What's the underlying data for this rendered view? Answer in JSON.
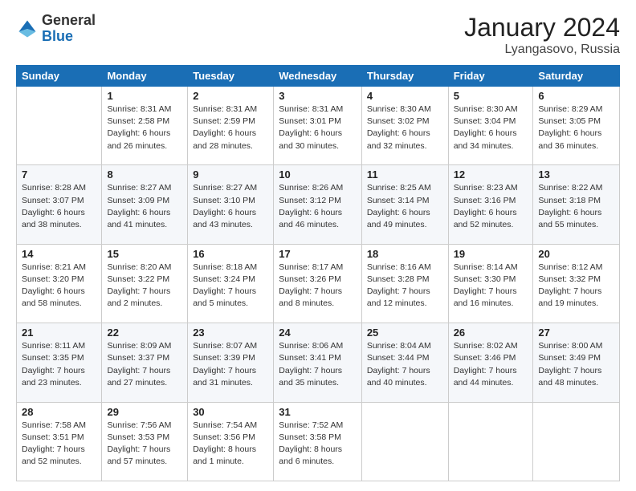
{
  "logo": {
    "general": "General",
    "blue": "Blue"
  },
  "title": "January 2024",
  "location": "Lyangasovo, Russia",
  "days_of_week": [
    "Sunday",
    "Monday",
    "Tuesday",
    "Wednesday",
    "Thursday",
    "Friday",
    "Saturday"
  ],
  "weeks": [
    [
      {
        "day": "",
        "info": ""
      },
      {
        "day": "1",
        "info": "Sunrise: 8:31 AM\nSunset: 2:58 PM\nDaylight: 6 hours\nand 26 minutes."
      },
      {
        "day": "2",
        "info": "Sunrise: 8:31 AM\nSunset: 2:59 PM\nDaylight: 6 hours\nand 28 minutes."
      },
      {
        "day": "3",
        "info": "Sunrise: 8:31 AM\nSunset: 3:01 PM\nDaylight: 6 hours\nand 30 minutes."
      },
      {
        "day": "4",
        "info": "Sunrise: 8:30 AM\nSunset: 3:02 PM\nDaylight: 6 hours\nand 32 minutes."
      },
      {
        "day": "5",
        "info": "Sunrise: 8:30 AM\nSunset: 3:04 PM\nDaylight: 6 hours\nand 34 minutes."
      },
      {
        "day": "6",
        "info": "Sunrise: 8:29 AM\nSunset: 3:05 PM\nDaylight: 6 hours\nand 36 minutes."
      }
    ],
    [
      {
        "day": "7",
        "info": "Sunrise: 8:28 AM\nSunset: 3:07 PM\nDaylight: 6 hours\nand 38 minutes."
      },
      {
        "day": "8",
        "info": "Sunrise: 8:27 AM\nSunset: 3:09 PM\nDaylight: 6 hours\nand 41 minutes."
      },
      {
        "day": "9",
        "info": "Sunrise: 8:27 AM\nSunset: 3:10 PM\nDaylight: 6 hours\nand 43 minutes."
      },
      {
        "day": "10",
        "info": "Sunrise: 8:26 AM\nSunset: 3:12 PM\nDaylight: 6 hours\nand 46 minutes."
      },
      {
        "day": "11",
        "info": "Sunrise: 8:25 AM\nSunset: 3:14 PM\nDaylight: 6 hours\nand 49 minutes."
      },
      {
        "day": "12",
        "info": "Sunrise: 8:23 AM\nSunset: 3:16 PM\nDaylight: 6 hours\nand 52 minutes."
      },
      {
        "day": "13",
        "info": "Sunrise: 8:22 AM\nSunset: 3:18 PM\nDaylight: 6 hours\nand 55 minutes."
      }
    ],
    [
      {
        "day": "14",
        "info": "Sunrise: 8:21 AM\nSunset: 3:20 PM\nDaylight: 6 hours\nand 58 minutes."
      },
      {
        "day": "15",
        "info": "Sunrise: 8:20 AM\nSunset: 3:22 PM\nDaylight: 7 hours\nand 2 minutes."
      },
      {
        "day": "16",
        "info": "Sunrise: 8:18 AM\nSunset: 3:24 PM\nDaylight: 7 hours\nand 5 minutes."
      },
      {
        "day": "17",
        "info": "Sunrise: 8:17 AM\nSunset: 3:26 PM\nDaylight: 7 hours\nand 8 minutes."
      },
      {
        "day": "18",
        "info": "Sunrise: 8:16 AM\nSunset: 3:28 PM\nDaylight: 7 hours\nand 12 minutes."
      },
      {
        "day": "19",
        "info": "Sunrise: 8:14 AM\nSunset: 3:30 PM\nDaylight: 7 hours\nand 16 minutes."
      },
      {
        "day": "20",
        "info": "Sunrise: 8:12 AM\nSunset: 3:32 PM\nDaylight: 7 hours\nand 19 minutes."
      }
    ],
    [
      {
        "day": "21",
        "info": "Sunrise: 8:11 AM\nSunset: 3:35 PM\nDaylight: 7 hours\nand 23 minutes."
      },
      {
        "day": "22",
        "info": "Sunrise: 8:09 AM\nSunset: 3:37 PM\nDaylight: 7 hours\nand 27 minutes."
      },
      {
        "day": "23",
        "info": "Sunrise: 8:07 AM\nSunset: 3:39 PM\nDaylight: 7 hours\nand 31 minutes."
      },
      {
        "day": "24",
        "info": "Sunrise: 8:06 AM\nSunset: 3:41 PM\nDaylight: 7 hours\nand 35 minutes."
      },
      {
        "day": "25",
        "info": "Sunrise: 8:04 AM\nSunset: 3:44 PM\nDaylight: 7 hours\nand 40 minutes."
      },
      {
        "day": "26",
        "info": "Sunrise: 8:02 AM\nSunset: 3:46 PM\nDaylight: 7 hours\nand 44 minutes."
      },
      {
        "day": "27",
        "info": "Sunrise: 8:00 AM\nSunset: 3:49 PM\nDaylight: 7 hours\nand 48 minutes."
      }
    ],
    [
      {
        "day": "28",
        "info": "Sunrise: 7:58 AM\nSunset: 3:51 PM\nDaylight: 7 hours\nand 52 minutes."
      },
      {
        "day": "29",
        "info": "Sunrise: 7:56 AM\nSunset: 3:53 PM\nDaylight: 7 hours\nand 57 minutes."
      },
      {
        "day": "30",
        "info": "Sunrise: 7:54 AM\nSunset: 3:56 PM\nDaylight: 8 hours\nand 1 minute."
      },
      {
        "day": "31",
        "info": "Sunrise: 7:52 AM\nSunset: 3:58 PM\nDaylight: 8 hours\nand 6 minutes."
      },
      {
        "day": "",
        "info": ""
      },
      {
        "day": "",
        "info": ""
      },
      {
        "day": "",
        "info": ""
      }
    ]
  ]
}
